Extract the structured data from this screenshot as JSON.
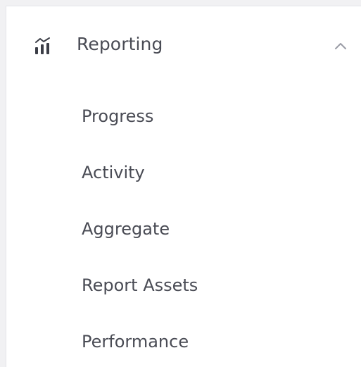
{
  "section": {
    "title": "Reporting",
    "icon": "chart-bars-icon",
    "expanded": true,
    "toggle_icon": "chevron-up-icon"
  },
  "menu": {
    "items": [
      {
        "label": "Progress"
      },
      {
        "label": "Activity"
      },
      {
        "label": "Aggregate"
      },
      {
        "label": "Report Assets"
      },
      {
        "label": "Performance"
      }
    ]
  },
  "colors": {
    "text": "#4a4c55",
    "icon": "#3b3d46",
    "chevron": "#9a9ca6",
    "border": "#e3e4e8",
    "background": "#ffffff",
    "outer_background": "#f1f1f3"
  }
}
